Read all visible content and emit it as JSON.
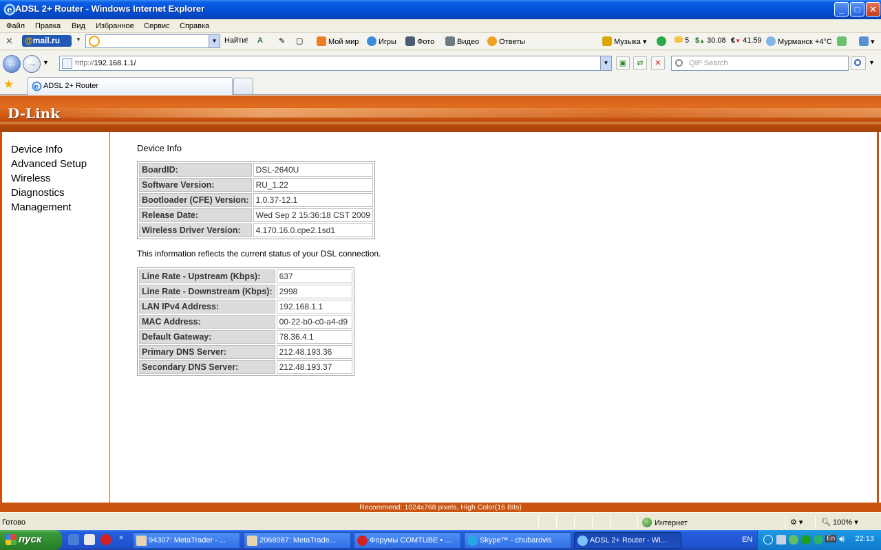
{
  "window": {
    "title": "ADSL 2+ Router - Windows Internet Explorer",
    "min": "_",
    "max": "□",
    "close": "✕"
  },
  "menu": [
    "Файл",
    "Правка",
    "Вид",
    "Избранное",
    "Сервис",
    "Справка"
  ],
  "mailru": {
    "close": "✕",
    "logo_at": "@",
    "logo_text": "mail.ru",
    "find_button": "Найти!",
    "items": {
      "moy_mir": "Мой мир",
      "igry": "Игры",
      "foto": "Фото",
      "video": "Видео",
      "otvety": "Ответы",
      "muzyka": "Музыка",
      "mail_count": "5",
      "usd": "30.08",
      "eur": "41.59",
      "weather": "Мурманск +4°C"
    }
  },
  "address": {
    "scheme": "http://",
    "host": "192.168.1.1/",
    "search_placeholder": "QIP Search"
  },
  "tabs": [
    {
      "label": "ADSL 2+ Router"
    }
  ],
  "page": {
    "brand": "D-Link",
    "nav": [
      "Device Info",
      "Advanced Setup",
      "Wireless",
      "Diagnostics",
      "Management"
    ],
    "heading": "Device Info",
    "device_table": [
      {
        "key": "BoardID:",
        "value": "DSL-2640U"
      },
      {
        "key": "Software Version:",
        "value": "RU_1.22"
      },
      {
        "key": "Bootloader (CFE) Version:",
        "value": "1.0.37-12.1"
      },
      {
        "key": "Release Date:",
        "value": "Wed Sep 2 15:36:18 CST 2009"
      },
      {
        "key": "Wireless Driver Version:",
        "value": "4.170.16.0.cpe2.1sd1"
      }
    ],
    "note": "This information reflects the current status of your DSL connection.",
    "dsl_table": [
      {
        "key": "Line Rate - Upstream (Kbps):",
        "value": "637"
      },
      {
        "key": "Line Rate - Downstream (Kbps):",
        "value": "2998"
      },
      {
        "key": "LAN IPv4 Address:",
        "value": "192.168.1.1"
      },
      {
        "key": "MAC Address:",
        "value": "00-22-b0-c0-a4-d9"
      },
      {
        "key": "Default Gateway:",
        "value": "78.36.4.1"
      },
      {
        "key": "Primary DNS Server:",
        "value": "212.48.193.36"
      },
      {
        "key": "Secondary DNS Server:",
        "value": "212.48.193.37"
      }
    ],
    "footer": "Recommend: 1024x768 pixels, High Color(16 Bits)"
  },
  "status": {
    "text": "Готово",
    "zone": "Интернет",
    "zoom": "100%"
  },
  "taskbar": {
    "start": "пуск",
    "tasks": [
      {
        "label": "94307: MetaTrader - ..."
      },
      {
        "label": "2068087: MetaTrade..."
      },
      {
        "label": "Форумы COMTUBE • ..."
      },
      {
        "label": "Skype™ - chubarovis"
      },
      {
        "label": "ADSL 2+ Router - Wi..."
      }
    ],
    "lang": "EN",
    "tray_lang": "En",
    "clock": "22:13"
  },
  "colors": {
    "dlink_orange": "#c9530f",
    "xp_blue": "#245edb",
    "start_green": "#3a9a3a"
  }
}
